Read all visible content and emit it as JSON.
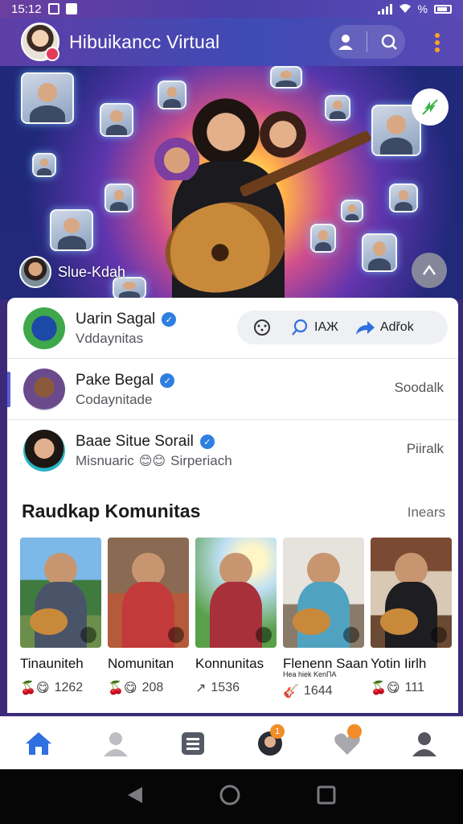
{
  "status_bar": {
    "time": "15:12",
    "battery": "%"
  },
  "header": {
    "title": "Hibuikancc Virtual"
  },
  "hero": {
    "user_label": "Slue-Kdah"
  },
  "feed": [
    {
      "name": "Uarin Sagal",
      "subtitle": "Vddaynitas",
      "verified": true
    },
    {
      "name": "Pake Begal",
      "subtitle": "Codaynitade",
      "verified": true,
      "action": "Soodalk"
    },
    {
      "name": "Baae Situe Sorail",
      "subtitle": "Misnuaric",
      "subtitle_emoji": "😊😊",
      "subtitle_tail": "Sirperiach",
      "verified": true,
      "action": "Piiralk"
    }
  ],
  "row1_actions": {
    "settings": "",
    "search_label": "IAЖ",
    "share_label": "Adřok"
  },
  "section": {
    "title": "Raudkap Komunitas",
    "link": "Inears"
  },
  "tiles": [
    {
      "label": "Tinauniteh",
      "caption": "",
      "count": "1262",
      "emoji": "🍒😋"
    },
    {
      "label": "Nomunitan",
      "caption": "",
      "count": "208",
      "emoji": "🍒😋"
    },
    {
      "label": "Konnunitas",
      "caption": "",
      "count": "1536",
      "emoji": "↗"
    },
    {
      "label": "Flenenn Saan",
      "caption": "Hea hiek KenΠA",
      "count": "1644",
      "emoji": "🎸"
    },
    {
      "label": "Yotin Iirlh",
      "caption": "",
      "count": "111",
      "emoji": "🍒😋"
    }
  ],
  "colors": {
    "accent": "#2f6fe0",
    "verified": "#2f7fe0",
    "badge": "#f28c28"
  },
  "bottom_nav": [
    {
      "icon": "home-icon",
      "active": true
    },
    {
      "icon": "profile-icon"
    },
    {
      "icon": "list-icon"
    },
    {
      "icon": "avatar-icon",
      "badge": "1"
    },
    {
      "icon": "heart-icon",
      "badge": ""
    },
    {
      "icon": "account-icon"
    }
  ]
}
